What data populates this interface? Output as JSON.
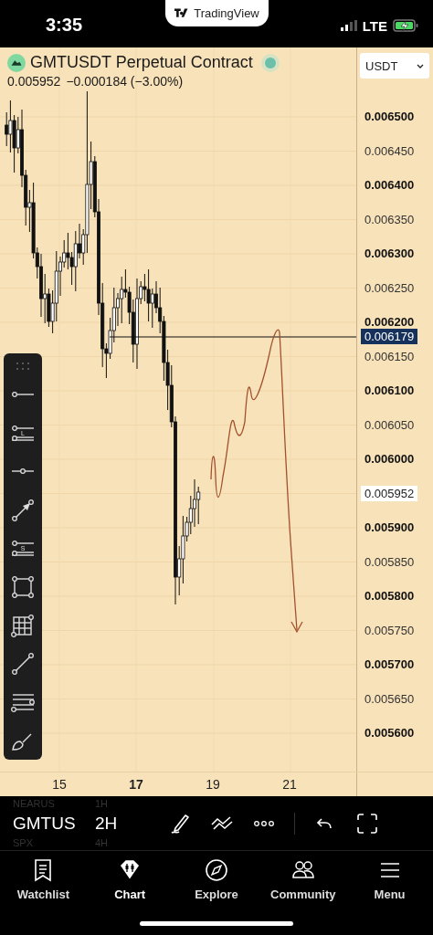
{
  "status_bar": {
    "time": "3:35",
    "app_pill": "TradingView",
    "network": "LTE"
  },
  "header": {
    "symbol_title": "GMTUSDT Perpetual Contract",
    "last_price": "0.005952",
    "change": "−0.000184 (−3.00%)",
    "currency_select": "USDT"
  },
  "price_axis": {
    "labels": [
      {
        "text": "0.006500",
        "kind": "major"
      },
      {
        "text": "0.006450",
        "kind": "minor"
      },
      {
        "text": "0.006400",
        "kind": "major"
      },
      {
        "text": "0.006350",
        "kind": "minor"
      },
      {
        "text": "0.006300",
        "kind": "major"
      },
      {
        "text": "0.006250",
        "kind": "minor"
      },
      {
        "text": "0.006200",
        "kind": "major"
      },
      {
        "text": "0.006150",
        "kind": "minor"
      },
      {
        "text": "0.006100",
        "kind": "major"
      },
      {
        "text": "0.006050",
        "kind": "minor"
      },
      {
        "text": "0.006000",
        "kind": "major"
      },
      {
        "text": "0.005952",
        "kind": "last_price_tag"
      },
      {
        "text": "0.005900",
        "kind": "major"
      },
      {
        "text": "0.005850",
        "kind": "minor"
      },
      {
        "text": "0.005800",
        "kind": "major"
      },
      {
        "text": "0.005750",
        "kind": "minor"
      },
      {
        "text": "0.005700",
        "kind": "major"
      },
      {
        "text": "0.005650",
        "kind": "minor"
      },
      {
        "text": "0.005600",
        "kind": "major"
      }
    ],
    "line_tag": "0.006179"
  },
  "time_axis": {
    "labels": [
      {
        "text": "15",
        "kind": "minor"
      },
      {
        "text": "17",
        "kind": "major"
      },
      {
        "text": "19",
        "kind": "minor"
      },
      {
        "text": "21",
        "kind": "minor"
      }
    ]
  },
  "drawing_tools": [
    {
      "kind": "ray"
    },
    {
      "kind": "position",
      "letter": "L"
    },
    {
      "kind": "horizontal"
    },
    {
      "kind": "arrow"
    },
    {
      "kind": "position",
      "letter": "S"
    },
    {
      "kind": "rectangle"
    },
    {
      "kind": "grid"
    },
    {
      "kind": "trendline"
    },
    {
      "kind": "channel"
    },
    {
      "kind": "brush"
    }
  ],
  "bottom_toolbar": {
    "symbols": [
      {
        "text": "NEARUS",
        "selected": false
      },
      {
        "text": "GMTUS",
        "selected": true
      },
      {
        "text": "SPX",
        "selected": false
      }
    ],
    "intervals": [
      {
        "text": "1H",
        "selected": false
      },
      {
        "text": "2H",
        "selected": true
      },
      {
        "text": "4H",
        "selected": false
      }
    ]
  },
  "tabs": [
    {
      "label": "Watchlist",
      "selected": false
    },
    {
      "label": "Chart",
      "selected": true
    },
    {
      "label": "Explore",
      "selected": false
    },
    {
      "label": "Community",
      "selected": false
    },
    {
      "label": "Menu",
      "selected": false
    }
  ]
}
